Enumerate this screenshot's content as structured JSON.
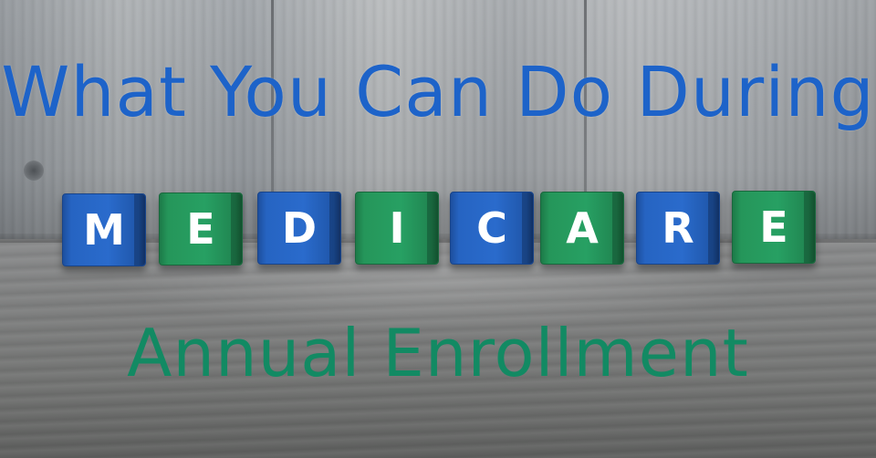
{
  "headline": "What You Can Do During",
  "subline": "Annual Enrollment",
  "blocks": [
    {
      "letter": "M",
      "color": "blue"
    },
    {
      "letter": "E",
      "color": "green"
    },
    {
      "letter": "D",
      "color": "blue"
    },
    {
      "letter": "I",
      "color": "green"
    },
    {
      "letter": "C",
      "color": "blue"
    },
    {
      "letter": "A",
      "color": "green"
    },
    {
      "letter": "R",
      "color": "blue"
    },
    {
      "letter": "E",
      "color": "green"
    }
  ],
  "colors": {
    "headline": "#1d63c9",
    "subline": "#128a63",
    "block_blue": "#2a6bcc",
    "block_green": "#27a063",
    "block_letter": "#ffffff"
  }
}
